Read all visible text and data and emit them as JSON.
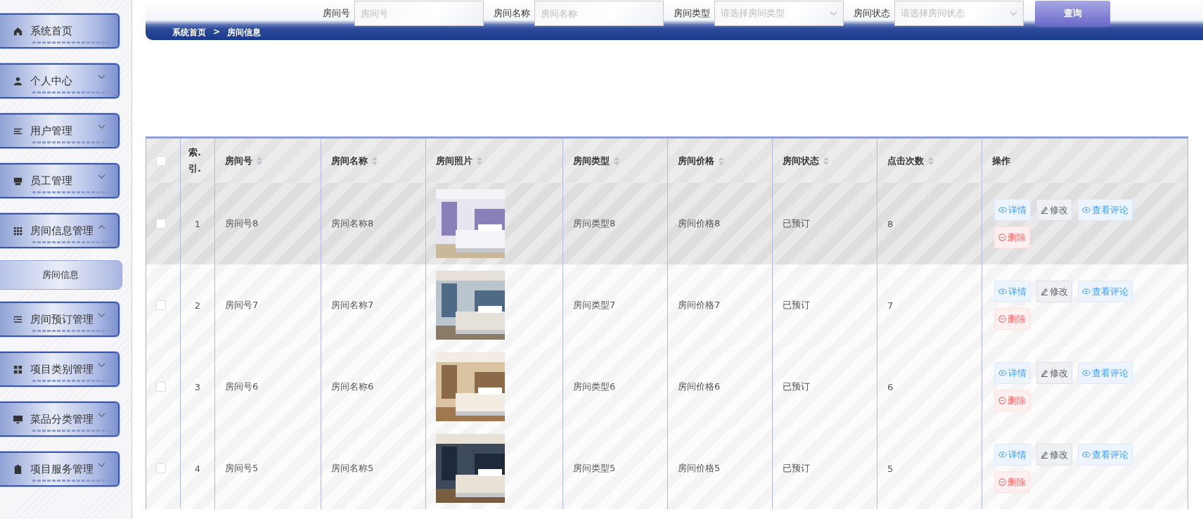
{
  "sidebar": {
    "items": [
      {
        "label": "系统首页",
        "kind": "link"
      },
      {
        "label": "个人中心",
        "kind": "menu",
        "expanded": false
      },
      {
        "label": "用户管理",
        "kind": "menu",
        "expanded": false
      },
      {
        "label": "员工管理",
        "kind": "menu",
        "expanded": false
      },
      {
        "label": "房间信息管理",
        "kind": "menu",
        "expanded": true,
        "children": [
          {
            "label": "房间信息"
          }
        ]
      },
      {
        "label": "房间预订管理",
        "kind": "menu",
        "expanded": false
      },
      {
        "label": "项目类别管理",
        "kind": "menu",
        "expanded": false
      },
      {
        "label": "菜品分类管理",
        "kind": "menu",
        "expanded": false
      },
      {
        "label": "项目服务管理",
        "kind": "menu",
        "expanded": false
      }
    ]
  },
  "search": {
    "fields": [
      {
        "label": "房间号",
        "placeholder": "房间号",
        "kind": "input"
      },
      {
        "label": "房间名称",
        "placeholder": "房间名称",
        "kind": "input"
      },
      {
        "label": "房间类型",
        "placeholder": "请选择房间类型",
        "kind": "select"
      },
      {
        "label": "房间状态",
        "placeholder": "请选择房间状态",
        "kind": "select"
      }
    ],
    "button": "查询"
  },
  "breadcrumb": [
    "系统首页",
    ">",
    "房间信息"
  ],
  "table": {
    "header_checkbox": {
      "checked": false
    },
    "columns": [
      {
        "label": "索.引.",
        "kind": "index"
      },
      {
        "label": "房间号",
        "kind": "sort"
      },
      {
        "label": "房间名称",
        "kind": "sort"
      },
      {
        "label": "房间照片",
        "kind": "sort"
      },
      {
        "label": "房间类型",
        "kind": "sort"
      },
      {
        "label": "房间价格",
        "kind": "sort"
      },
      {
        "label": "房间状态",
        "kind": "sort"
      },
      {
        "label": "点击次数",
        "kind": "sort"
      },
      {
        "label": "操作",
        "kind": "plain"
      }
    ],
    "rows": [
      {
        "checked": false,
        "highlighted": true,
        "index": "1",
        "number": "房间号8",
        "name": "房间名称8",
        "type": "房间类型8",
        "price": "房间价格8",
        "status": "已预订",
        "clicks": "8",
        "actions": [
          {
            "label": "详情",
            "kind": "view"
          },
          {
            "label": "修改",
            "kind": "edit"
          },
          {
            "label": "查看评论",
            "kind": "view"
          },
          {
            "label": "删除",
            "kind": "delete"
          }
        ]
      },
      {
        "checked": false,
        "highlighted": false,
        "index": "2",
        "number": "房间号7",
        "name": "房间名称7",
        "type": "房间类型7",
        "price": "房间价格7",
        "status": "已预订",
        "clicks": "7",
        "actions": [
          {
            "label": "详情",
            "kind": "view"
          },
          {
            "label": "修改",
            "kind": "edit"
          },
          {
            "label": "查看评论",
            "kind": "view"
          },
          {
            "label": "删除",
            "kind": "delete"
          }
        ]
      },
      {
        "checked": false,
        "highlighted": false,
        "index": "3",
        "number": "房间号6",
        "name": "房间名称6",
        "type": "房间类型6",
        "price": "房间价格6",
        "status": "已预订",
        "clicks": "6",
        "actions": [
          {
            "label": "详情",
            "kind": "view"
          },
          {
            "label": "修改",
            "kind": "edit"
          },
          {
            "label": "查看评论",
            "kind": "view"
          },
          {
            "label": "删除",
            "kind": "delete"
          }
        ]
      },
      {
        "checked": false,
        "highlighted": false,
        "index": "4",
        "number": "房间号5",
        "name": "房间名称5",
        "type": "房间类型5",
        "price": "房间价格5",
        "status": "已预订",
        "clicks": "5",
        "actions": [
          {
            "label": "详情",
            "kind": "view"
          },
          {
            "label": "修改",
            "kind": "edit"
          },
          {
            "label": "查看评论",
            "kind": "view"
          },
          {
            "label": "删除",
            "kind": "delete"
          }
        ]
      }
    ]
  }
}
